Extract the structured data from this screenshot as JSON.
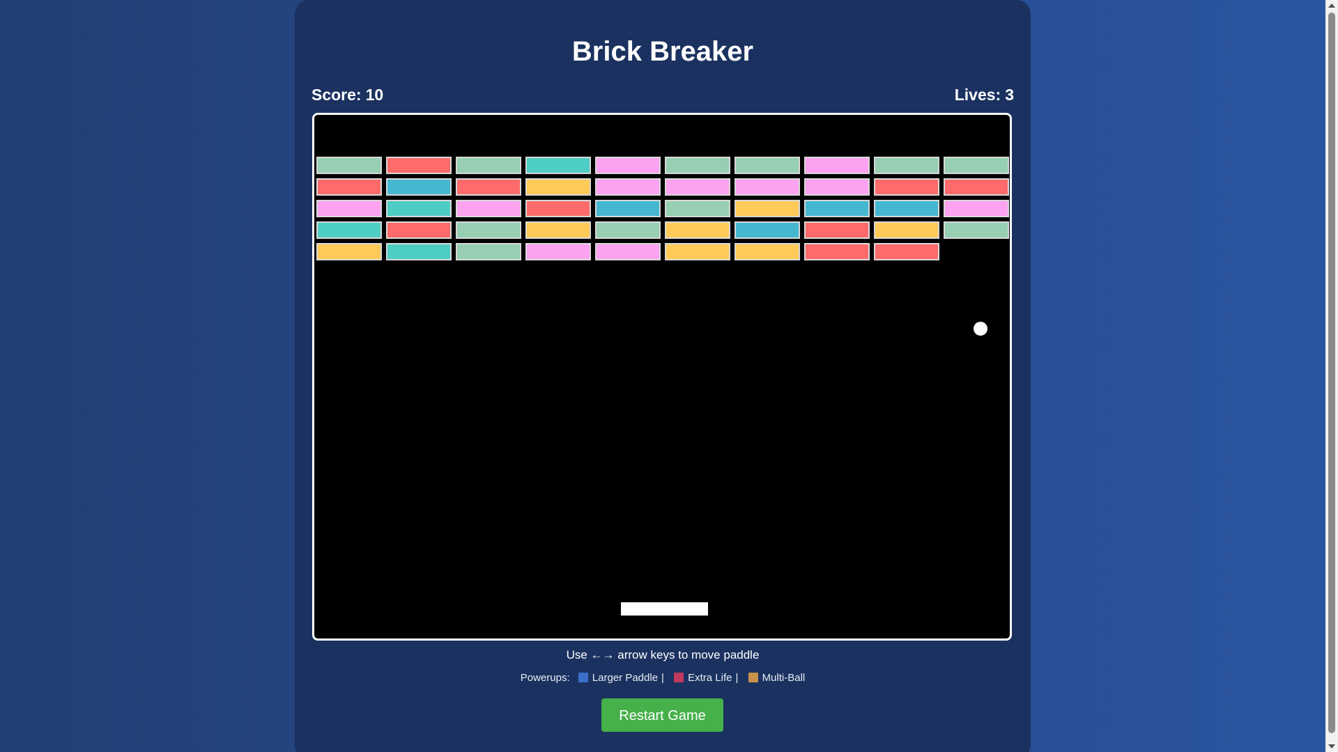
{
  "game": {
    "title": "Brick Breaker",
    "score_label": "Score:",
    "score": 10,
    "lives_label": "Lives:",
    "lives": 3,
    "instructions": "Use ←→ arrow keys to move paddle",
    "powerups": {
      "label": "Powerups:",
      "items": [
        {
          "name": "Larger Paddle",
          "color": "#3b6fc7"
        },
        {
          "name": "Extra Life",
          "color": "#c0395e"
        },
        {
          "name": "Multi-Ball",
          "color": "#c9914a"
        }
      ]
    },
    "restart_label": "Restart Game"
  },
  "bricks": {
    "colors": {
      "mint": "#96cfb1",
      "red": "#ff6b6b",
      "teal": "#4ecdc4",
      "pink": "#fda2f0",
      "blue": "#45b7d1",
      "yellow": "#ffca57"
    },
    "rows": [
      [
        "mint",
        "red",
        "mint",
        "teal",
        "pink",
        "mint",
        "mint",
        "pink",
        "mint",
        "mint"
      ],
      [
        "red",
        "blue",
        "red",
        "yellow",
        "pink",
        "pink",
        "pink",
        "pink",
        "red",
        "red"
      ],
      [
        "pink",
        "teal",
        "pink",
        "red",
        "blue",
        "mint",
        "yellow",
        "blue",
        "blue",
        "pink"
      ],
      [
        "teal",
        "red",
        "mint",
        "yellow",
        "mint",
        "yellow",
        "blue",
        "red",
        "yellow",
        "mint"
      ],
      [
        "yellow",
        "teal",
        "mint",
        "pink",
        "pink",
        "yellow",
        "yellow",
        "red",
        "red",
        null
      ]
    ]
  }
}
